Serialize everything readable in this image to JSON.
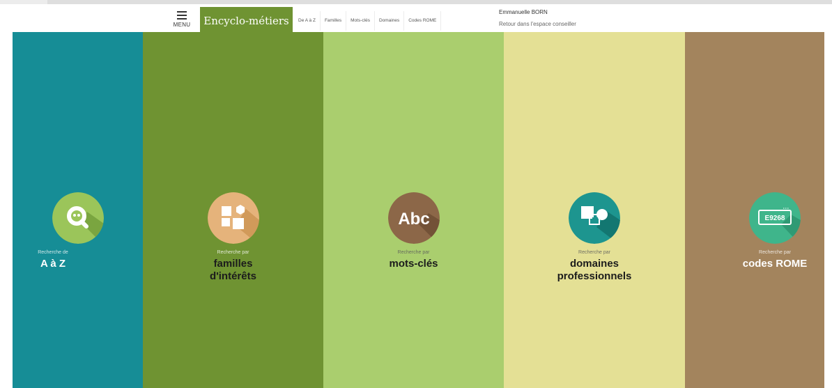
{
  "header": {
    "menu_label": "MENU",
    "logo": "Encyclo-métiers",
    "nav": [
      "De A à Z",
      "Familles",
      "Mots-clés",
      "Domaines",
      "Codes ROME"
    ],
    "user_name": "Emmanuelle BORN",
    "user_link": "Retour dans l'espace conseiller"
  },
  "columns": [
    {
      "sub": "Recherche de",
      "title": "A à Z",
      "color": "#168d96",
      "icon": "search-icon"
    },
    {
      "sub": "Recherche par",
      "title": "familles d'intérêts",
      "color": "#6f9332",
      "icon": "shapes-icon"
    },
    {
      "sub": "Recherche par",
      "title": "mots-clés",
      "color": "#aace6e",
      "icon": "abc-icon"
    },
    {
      "sub": "Recherche par",
      "title": "domaines professionnels",
      "color": "#e4e095",
      "icon": "domains-icon"
    },
    {
      "sub": "Recherche par",
      "title": "codes ROME",
      "color": "#a3845d",
      "icon": "rome-code-icon",
      "icon_text": "E9268"
    }
  ]
}
